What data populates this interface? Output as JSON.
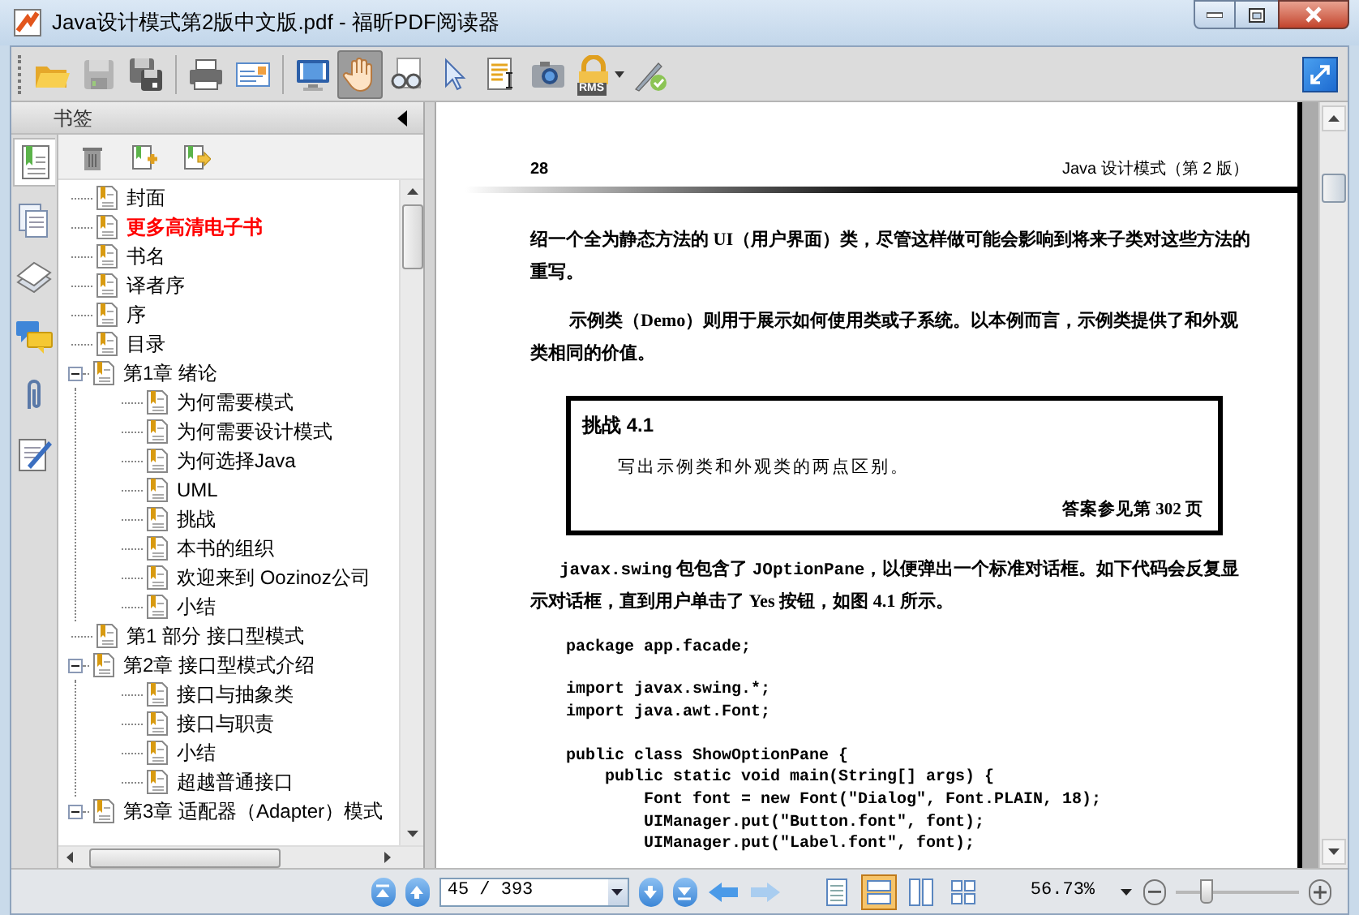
{
  "window": {
    "title": "Java设计模式第2版中文版.pdf - 福昕PDF阅读器"
  },
  "toolbar": [
    {
      "kind": "open",
      "selected": false,
      "disabled": false
    },
    {
      "kind": "save",
      "selected": false,
      "disabled": true
    },
    {
      "kind": "save-as",
      "selected": false,
      "disabled": false
    },
    {
      "kind": "print",
      "selected": false,
      "disabled": false
    },
    {
      "kind": "email",
      "selected": false,
      "disabled": false
    },
    {
      "kind": "fullscreen",
      "selected": false,
      "disabled": false
    },
    {
      "kind": "hand",
      "selected": true,
      "disabled": false
    },
    {
      "kind": "loupe",
      "selected": false,
      "disabled": false
    },
    {
      "kind": "select",
      "selected": false,
      "disabled": false
    },
    {
      "kind": "text-select",
      "selected": false,
      "disabled": false
    },
    {
      "kind": "snapshot",
      "selected": false,
      "disabled": false
    },
    {
      "kind": "rms",
      "selected": false,
      "disabled": false,
      "label": "RMS"
    },
    {
      "kind": "sign",
      "selected": false,
      "disabled": false
    }
  ],
  "side_strip": [
    {
      "kind": "bookmarks",
      "selected": true
    },
    {
      "kind": "pages",
      "selected": false
    },
    {
      "kind": "layers",
      "selected": false
    },
    {
      "kind": "comments",
      "selected": false
    },
    {
      "kind": "attachments",
      "selected": false
    },
    {
      "kind": "signatures",
      "selected": false
    }
  ],
  "bookmarks": {
    "title": "书签",
    "items": [
      {
        "label": "封面",
        "highlighted": false
      },
      {
        "label": "更多高清电子书",
        "highlighted": true
      },
      {
        "label": "书名",
        "highlighted": false
      },
      {
        "label": "译者序",
        "highlighted": false
      },
      {
        "label": "序",
        "highlighted": false
      },
      {
        "label": "目录",
        "highlighted": false
      },
      {
        "label": "第1章 绪论",
        "highlighted": false,
        "expanded": true,
        "children": [
          {
            "label": "为何需要模式",
            "highlighted": false
          },
          {
            "label": "为何需要设计模式",
            "highlighted": false
          },
          {
            "label": "为何选择Java",
            "highlighted": false
          },
          {
            "label": "UML",
            "highlighted": false
          },
          {
            "label": "挑战",
            "highlighted": false
          },
          {
            "label": "本书的组织",
            "highlighted": false
          },
          {
            "label": "欢迎来到 Oozinoz公司",
            "highlighted": false
          },
          {
            "label": "小结",
            "highlighted": false
          }
        ]
      },
      {
        "label": "第1 部分 接口型模式",
        "highlighted": false
      },
      {
        "label": "第2章 接口型模式介绍",
        "highlighted": false,
        "expanded": true,
        "children": [
          {
            "label": "接口与抽象类",
            "highlighted": false
          },
          {
            "label": "接口与职责",
            "highlighted": false
          },
          {
            "label": "小结",
            "highlighted": false
          },
          {
            "label": "超越普通接口",
            "highlighted": false
          }
        ]
      },
      {
        "label": "第3章 适配器（Adapter）模式",
        "highlighted": false,
        "expanded": true
      }
    ]
  },
  "page": {
    "number": "28",
    "running_title": "Java 设计模式（第 2 版）",
    "paragraphs_top": [
      [
        {
          "text": "绍一个全为静态方法的 UI（用户界面）类，尽管这样做可能会影响到将来子类对这些方法的重写。",
          "code": false
        }
      ],
      [
        {
          "text": "示例类（Demo）则用于展示如何使用类或子系统。以本例而言，示例类提供了和外观类相同的价值。",
          "code": false
        }
      ]
    ],
    "challenge": {
      "title": "挑战 4.1",
      "text": "写出示例类和外观类的两点区别。",
      "answer": "答案参见第 302 页"
    },
    "paragraphs_bottom": [
      [
        {
          "text": "javax.swing",
          "code": true
        },
        {
          "text": " 包包含了 ",
          "code": false
        },
        {
          "text": "JOptionPane",
          "code": true
        },
        {
          "text": "，以便弹出一个标准对话框。如下代码会反复显示对话框，直到用户单击了 Yes 按钮，如图 4.1 所示。",
          "code": false
        }
      ]
    ],
    "code": [
      [
        "package app.facade;"
      ],
      [
        "import javax.swing.*;",
        "import java.awt.Font;"
      ],
      [
        "public class ShowOptionPane {",
        "    public static void main(String[] args) {",
        "        Font font = new Font(\"Dialog\", Font.PLAIN, 18);",
        "        UIManager.put(\"Button.font\", font);",
        "        UIManager.put(\"Label.font\", font);"
      ]
    ]
  },
  "status_bar": {
    "page_field": "45 / 393",
    "views": [
      {
        "kind": "single",
        "selected": false
      },
      {
        "kind": "continuous",
        "selected": true
      },
      {
        "kind": "facing",
        "selected": false
      },
      {
        "kind": "continuous-facing",
        "selected": false
      }
    ],
    "zoom": "56.73%",
    "zoom_slider": {
      "level": 0.25
    }
  }
}
